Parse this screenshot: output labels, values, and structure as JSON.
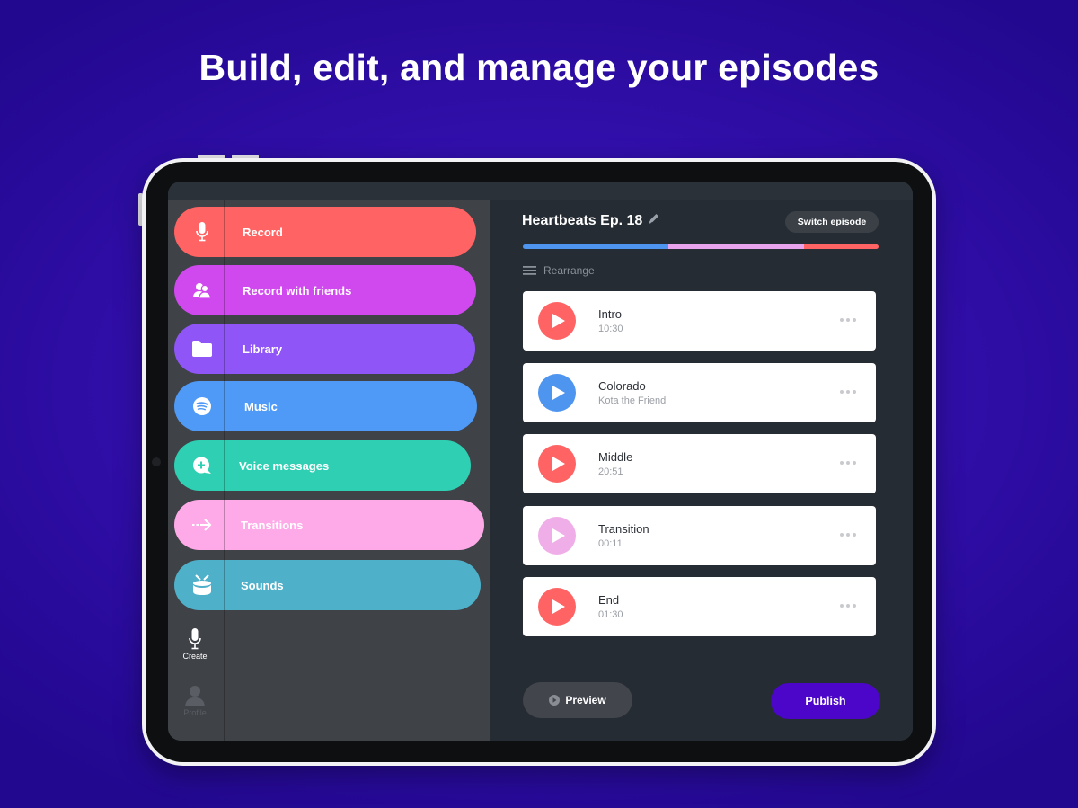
{
  "headline": "Build, edit, and manage your episodes",
  "sidebar": {
    "items": [
      {
        "label": "Record",
        "icon": "microphone-icon",
        "color": "#ff6363"
      },
      {
        "label": "Record with friends",
        "icon": "friends-icon",
        "color": "#d049ee"
      },
      {
        "label": "Library",
        "icon": "folder-icon",
        "color": "#8f55f7"
      },
      {
        "label": "Music",
        "icon": "spotify-icon",
        "color": "#4e9af6"
      },
      {
        "label": "Voice messages",
        "icon": "voice-message-icon",
        "color": "#2ecfb2"
      },
      {
        "label": "Transitions",
        "icon": "arrow-right-icon",
        "color": "#ffaae8"
      },
      {
        "label": "Sounds",
        "icon": "drum-icon",
        "color": "#4fb0c9"
      }
    ],
    "tabbar": {
      "create": {
        "label": "Create",
        "icon": "microphone-icon",
        "active": true
      },
      "profile": {
        "label": "Profile",
        "icon": "profile-icon",
        "active": false
      }
    }
  },
  "episode": {
    "title": "Heartbeats Ep. 18",
    "edit_icon": "pencil-icon",
    "switch_label": "Switch episode",
    "progress_segments": [
      {
        "name": "music",
        "fraction": 0.41,
        "color": "#4e95ef"
      },
      {
        "name": "transition",
        "fraction": 0.38,
        "color": "#e9a2ec"
      },
      {
        "name": "voice",
        "fraction": 0.21,
        "color": "#ff6363"
      }
    ],
    "rearrange_label": "Rearrange",
    "segments": [
      {
        "name": "Intro",
        "subtitle": "10:30",
        "color": "#ff6363"
      },
      {
        "name": "Colorado",
        "subtitle": "Kota the Friend",
        "color": "#4e95ef"
      },
      {
        "name": "Middle",
        "subtitle": "20:51",
        "color": "#ff6363"
      },
      {
        "name": "Transition",
        "subtitle": "00:11",
        "color": "#f0aee8"
      },
      {
        "name": "End",
        "subtitle": "01:30",
        "color": "#ff6363"
      }
    ],
    "preview_label": "Preview",
    "publish_label": "Publish",
    "publish_color": "#4b06c9"
  }
}
